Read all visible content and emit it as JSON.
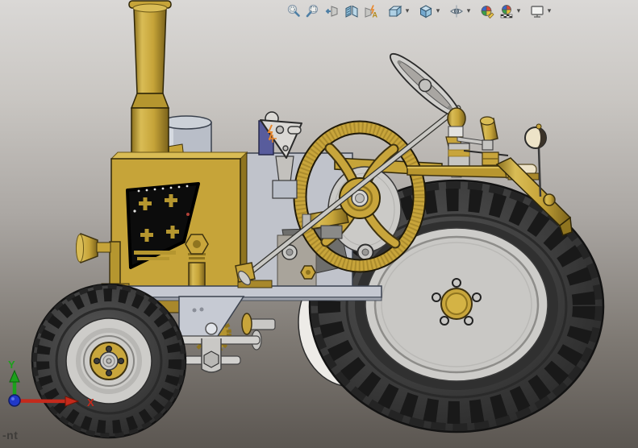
{
  "viewport": {
    "type": "3d-cad-graphics-area",
    "model_description": "gold antique tractor, left side view",
    "background": {
      "top": "#DAD8D6",
      "middle": "#ABA7A3",
      "bottom": "#5B5651"
    },
    "watermark_fragment": "-nt"
  },
  "toolbar": {
    "items": [
      {
        "name": "zoom-to-fit",
        "has_dropdown": false
      },
      {
        "name": "zoom-to-area",
        "has_dropdown": false
      },
      {
        "name": "previous-view",
        "has_dropdown": false
      },
      {
        "name": "section-view",
        "has_dropdown": false
      },
      {
        "name": "annotation-views",
        "has_dropdown": false,
        "glyph_letter": "A"
      },
      {
        "name": "view-orientation",
        "has_dropdown": true
      },
      {
        "name": "display-style",
        "has_dropdown": true
      },
      {
        "name": "hide-show-items",
        "has_dropdown": true
      },
      {
        "name": "edit-appearance",
        "has_dropdown": false
      },
      {
        "name": "apply-scene",
        "has_dropdown": true
      },
      {
        "name": "view-settings",
        "has_dropdown": true
      }
    ]
  },
  "triad": {
    "x_label": "X",
    "y_label": "Y",
    "x_color": "#C42A1C",
    "y_color": "#1CA01C",
    "z_color": "#2038C8"
  },
  "model_palette": {
    "body_gold": "#C6A439",
    "body_gold_light": "#D9BC55",
    "body_gold_dark": "#8F741F",
    "tire": "#3B3B3B",
    "rim_silver": "#C9C8C5",
    "frame_silver": "#C5C8D1",
    "seat_cream": "#EDE3C8",
    "sketch_marker_orange": "#E8862A",
    "panel_blue": "#585C9C"
  },
  "components": [
    "exhaust-stack",
    "air-tank",
    "engine-block",
    "engine-side-cutout",
    "headlight",
    "grease-pump",
    "chassis-frame",
    "front-axle-steering",
    "front-wheel",
    "flywheel",
    "clutch-disc",
    "governor-bracket",
    "steering-column",
    "steering-wheel",
    "rear-wheel",
    "far-rear-wheel",
    "operator-platform",
    "seat",
    "fender",
    "rear-lamp",
    "gear-lever"
  ]
}
